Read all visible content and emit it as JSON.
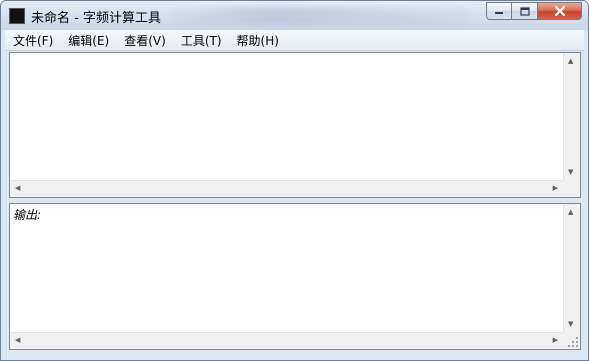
{
  "window": {
    "title": "未命名 - 字频计算工具"
  },
  "menu": {
    "items": [
      {
        "label": "文件(F)"
      },
      {
        "label": "编辑(E)"
      },
      {
        "label": "查看(V)"
      },
      {
        "label": "工具(T)"
      },
      {
        "label": "帮助(H)"
      }
    ]
  },
  "input_pane": {
    "text": ""
  },
  "output_pane": {
    "label": "输出:",
    "text": ""
  },
  "icons": {
    "app": "app-icon",
    "minimize": "minimize-icon",
    "maximize": "maximize-icon",
    "close": "close-icon",
    "scroll_up": "arrow-up-icon",
    "scroll_down": "arrow-down-icon",
    "scroll_left": "arrow-left-icon",
    "scroll_right": "arrow-right-icon",
    "resize": "resize-grip-icon"
  },
  "colors": {
    "titlebar": "#d5e1ef",
    "close_button": "#c2442a",
    "frame": "#dbe6f3"
  }
}
